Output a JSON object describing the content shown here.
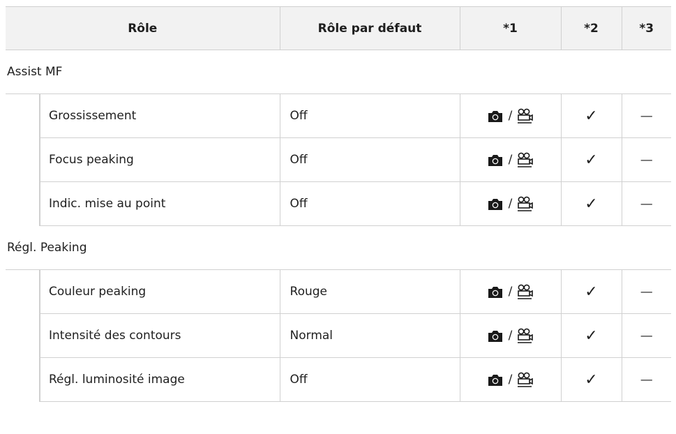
{
  "table": {
    "headers": [
      "Rôle",
      "Rôle par défaut",
      "*1",
      "*2",
      "*3"
    ],
    "sections": [
      {
        "title": "Assist MF",
        "rows": [
          {
            "role": "Grossissement",
            "default": "Off",
            "c1_slash": "/",
            "c2": "✓",
            "c3": "—"
          },
          {
            "role": "Focus peaking",
            "default": "Off",
            "c1_slash": "/",
            "c2": "✓",
            "c3": "—"
          },
          {
            "role": "Indic. mise au point",
            "default": "Off",
            "c1_slash": "/",
            "c2": "✓",
            "c3": "—"
          }
        ]
      },
      {
        "title": "Régl. Peaking",
        "rows": [
          {
            "role": "Couleur peaking",
            "default": "Rouge",
            "c1_slash": "/",
            "c2": "✓",
            "c3": "—"
          },
          {
            "role": "Intensité des contours",
            "default": "Normal",
            "c1_slash": "/",
            "c2": "✓",
            "c3": "—"
          },
          {
            "role": "Régl. luminosité image",
            "default": "Off",
            "c1_slash": "/",
            "c2": "✓",
            "c3": "—"
          }
        ]
      }
    ],
    "icons": {
      "still": "still-camera-icon",
      "movie": "movie-camera-icon"
    }
  }
}
